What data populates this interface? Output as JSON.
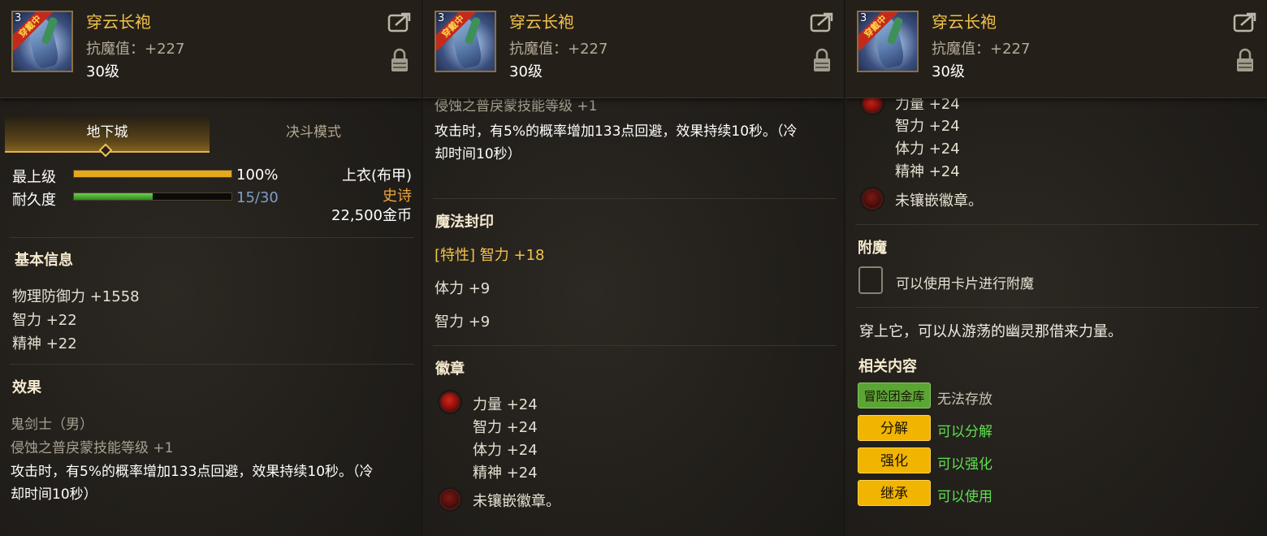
{
  "item": {
    "name": "穿云长袍",
    "stat": "抗魔值：+227",
    "level": "30级",
    "qty": "3",
    "ribbon": "穿戴中"
  },
  "p1": {
    "tabs": [
      "地下城",
      "决斗模式"
    ],
    "max_level_label": "最上级",
    "max_level_value": "100%",
    "max_level_fill": 1.0,
    "durability_label": "耐久度",
    "durability_value": "15/30",
    "durability_fill": 0.5,
    "slot_type": "上衣(布甲)",
    "rarity": "史诗",
    "price": "22,500金币",
    "basic_title": "基本信息",
    "basic_stats": [
      "物理防御力 +1558",
      "智力 +22",
      "精神 +22"
    ],
    "effect_title": "效果",
    "effect_class": "鬼剑士（男）",
    "effect_skill": "侵蚀之普戾蒙技能等级 +1",
    "effect_text_1": "攻击时，有5%的概率增加133点回避，效果持续10秒。（冷",
    "effect_text_2": "却时间10秒）"
  },
  "p2": {
    "cut_line": "侵蚀之普戾蒙技能等级 +1",
    "effect_text_1": "攻击时，有5%的概率增加133点回避，效果持续10秒。（冷",
    "effect_text_2": "却时间10秒）",
    "seal_title": "魔法封印",
    "seal_trait": "[特性] 智力 +18",
    "seal_stats": [
      "体力 +9",
      "智力 +9"
    ],
    "emblem_title": "徽章",
    "emblem_stats": [
      "力量 +24",
      "智力 +24",
      "体力 +24",
      "精神 +24"
    ],
    "emblem_empty": "未镶嵌徽章。"
  },
  "p3": {
    "cut_line": "力量 +24",
    "emblem_stats": [
      "智力 +24",
      "体力 +24",
      "精神 +24"
    ],
    "emblem_empty": "未镶嵌徽章。",
    "enchant_title": "附魔",
    "enchant_text": "可以使用卡片进行附魔",
    "flavor": "穿上它，可以从游荡的幽灵那借来力量。",
    "related_title": "相关内容",
    "related": [
      {
        "tag": "冒险团金库",
        "text": "无法存放"
      },
      {
        "tag": "分解",
        "text": "可以分解"
      },
      {
        "tag": "强化",
        "text": "可以强化"
      },
      {
        "tag": "继承",
        "text": "可以使用"
      }
    ]
  },
  "colors": {
    "gold": "#f2c24a",
    "orange_bar": "#e8a81c",
    "green_bar": "#3fae2a",
    "blue_value": "#7d9ec8",
    "available_green": "#5fe04f"
  }
}
